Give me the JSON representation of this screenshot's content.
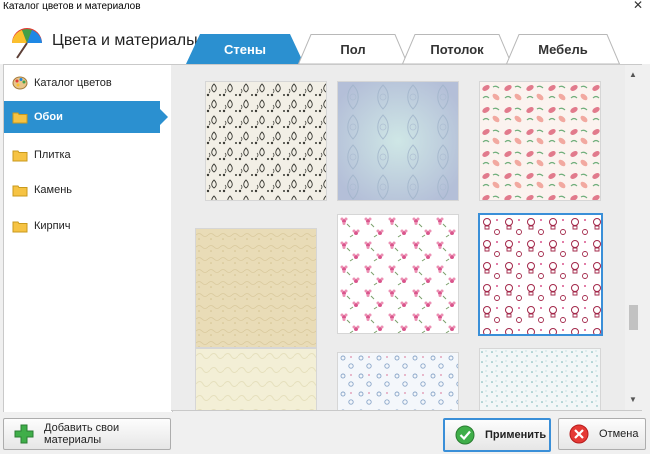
{
  "window": {
    "title": "Каталог цветов и материалов",
    "close_glyph": "✕"
  },
  "header": {
    "title": "Цвета и материалы",
    "logo_icon": "umbrella-palette-icon"
  },
  "tabs": [
    {
      "label": "Стены",
      "active": true
    },
    {
      "label": "Пол",
      "active": false
    },
    {
      "label": "Потолок",
      "active": false
    },
    {
      "label": "Мебель",
      "active": false
    }
  ],
  "sidebar": {
    "items": [
      {
        "label": "Каталог цветов",
        "icon": "palette-icon",
        "active": false
      },
      {
        "label": "Обои",
        "icon": "folder-icon",
        "active": true
      },
      {
        "label": "Плитка",
        "icon": "folder-icon",
        "active": false
      },
      {
        "label": "Камень",
        "icon": "folder-icon",
        "active": false
      },
      {
        "label": "Кирпич",
        "icon": "folder-icon",
        "active": false
      }
    ]
  },
  "grid": {
    "selected_index": 5,
    "tiles": [
      {
        "pattern": "dark-damask",
        "base": "#f2efe6",
        "ink": "#3b3b35"
      },
      {
        "pattern": "blue-damask",
        "base": "#b9c8da",
        "ink": "#9fb3c9"
      },
      {
        "pattern": "pink-floral",
        "base": "#fbf3ef",
        "ink": "#e27a8c"
      },
      {
        "pattern": "beige-texture",
        "base": "#e9dcb7",
        "ink": "#d9c99c"
      },
      {
        "pattern": "pink-flowers",
        "base": "#ffffff",
        "ink": "#d9558c"
      },
      {
        "pattern": "maroon-outline",
        "base": "#ffffff",
        "ink": "#a3284a"
      },
      {
        "pattern": "cream-texture",
        "base": "#f3efd6",
        "ink": "#e6e0bd"
      },
      {
        "pattern": "blue-floral",
        "base": "#f4f7fb",
        "ink": "#8aa6c9"
      },
      {
        "pattern": "teal-speckle",
        "base": "#f2f7f7",
        "ink": "#6fb0b2"
      }
    ]
  },
  "buttons": {
    "add_materials": "Добавить свои материалы",
    "apply": "Применить",
    "cancel": "Отмена"
  },
  "colors": {
    "accent": "#2b90d0",
    "selection": "#3a8fd8"
  }
}
